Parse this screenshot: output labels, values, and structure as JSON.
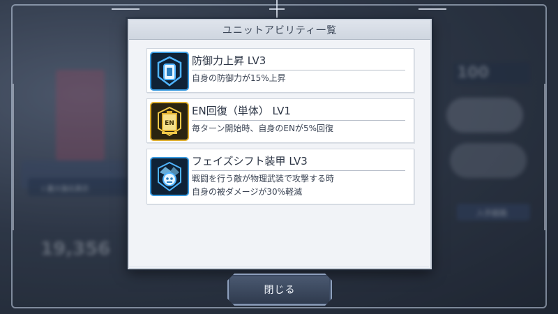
{
  "dialog": {
    "title": "ユニットアビリティ一覧",
    "abilities": [
      {
        "name": "防御力上昇 LV3",
        "desc1": "自身の防御力が15%上昇",
        "desc2": "",
        "icon": "shield-icon",
        "color": "#2a7fc0"
      },
      {
        "name": "EN回復（単体） LV1",
        "desc1": "毎ターン開始時、自身のENが5%回復",
        "desc2": "",
        "icon": "en-battery-icon",
        "color": "#d9a21b"
      },
      {
        "name": "フェイズシフト装甲 LV3",
        "desc1": "戦闘を行う敵が物理武装で攻撃する時",
        "desc2": "自身の被ダメージが30%軽減",
        "icon": "armor-robot-icon",
        "color": "#2a7fc0"
      }
    ],
    "close_label": "閉じる"
  },
  "background": {
    "stat_value": "100",
    "big_number": "19,356",
    "checkbox_label": "I 最大強化表示",
    "acquire_label": "入手経路"
  }
}
